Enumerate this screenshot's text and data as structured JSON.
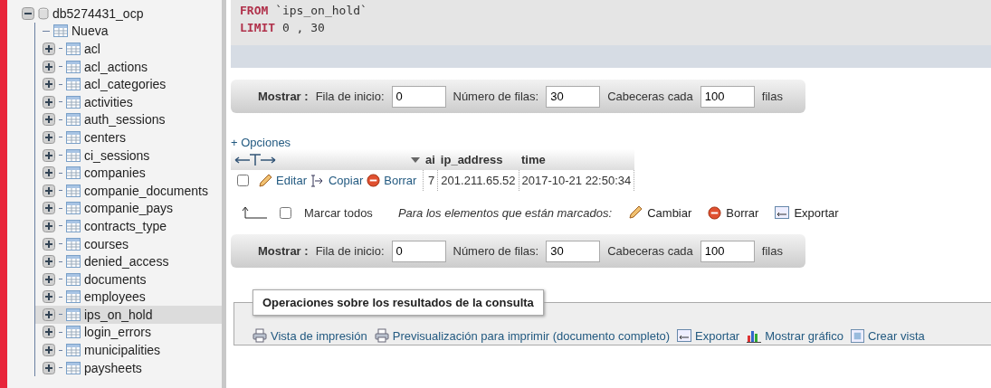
{
  "tree": {
    "label": "db5274431_ocp",
    "expanded": true,
    "children": [
      {
        "label": "Nueva",
        "kind": "new",
        "selected": false
      },
      {
        "label": "acl",
        "kind": "table",
        "selected": false
      },
      {
        "label": "acl_actions",
        "kind": "table",
        "selected": false
      },
      {
        "label": "acl_categories",
        "kind": "table",
        "selected": false
      },
      {
        "label": "activities",
        "kind": "table",
        "selected": false
      },
      {
        "label": "auth_sessions",
        "kind": "table",
        "selected": false
      },
      {
        "label": "centers",
        "kind": "table",
        "selected": false
      },
      {
        "label": "ci_sessions",
        "kind": "table",
        "selected": false
      },
      {
        "label": "companies",
        "kind": "table",
        "selected": false
      },
      {
        "label": "companie_documents",
        "kind": "table",
        "selected": false
      },
      {
        "label": "companie_pays",
        "kind": "table",
        "selected": false
      },
      {
        "label": "contracts_type",
        "kind": "table",
        "selected": false
      },
      {
        "label": "courses",
        "kind": "table",
        "selected": false
      },
      {
        "label": "denied_access",
        "kind": "table",
        "selected": false
      },
      {
        "label": "documents",
        "kind": "table",
        "selected": false
      },
      {
        "label": "employees",
        "kind": "table",
        "selected": false
      },
      {
        "label": "ips_on_hold",
        "kind": "table",
        "selected": true
      },
      {
        "label": "login_errors",
        "kind": "table",
        "selected": false
      },
      {
        "label": "municipalities",
        "kind": "table",
        "selected": false
      },
      {
        "label": "paysheets",
        "kind": "table",
        "selected": false
      }
    ]
  },
  "sql": [
    {
      "keyword": "FROM",
      "rest": "`ips_on_hold`"
    },
    {
      "keyword": "LIMIT",
      "rest": "0 , 30"
    }
  ],
  "nav_bars": [
    {
      "title": "Mostrar :",
      "start_label": "Fila de inicio:",
      "start": "0",
      "rows_label": "Número de filas:",
      "rows": "30",
      "headers_label": "Cabeceras cada",
      "headers": "100",
      "suffix": "filas"
    },
    {
      "title": "Mostrar :",
      "start_label": "Fila de inicio:",
      "start": "0",
      "rows_label": "Número de filas:",
      "rows": "30",
      "headers_label": "Cabeceras cada",
      "headers": "100",
      "suffix": "filas"
    }
  ],
  "options_link": "+ Opciones",
  "table": {
    "columns": [
      "ai",
      "ip_address",
      "time"
    ],
    "rows": [
      {
        "checked": false,
        "actions": [
          "Editar",
          "Copiar",
          "Borrar"
        ],
        "cells": [
          "7",
          "201.211.65.52",
          "2017-10-21 22:50:34"
        ]
      }
    ]
  },
  "bulk": {
    "check_all": "Marcar todos",
    "checked": false,
    "with_selected": "Para los elementos que están marcados:",
    "actions": [
      {
        "kind": "edit",
        "label": "Cambiar"
      },
      {
        "kind": "delete",
        "label": "Borrar"
      },
      {
        "kind": "export",
        "label": "Exportar"
      }
    ]
  },
  "operations": {
    "legend": "Operaciones sobre los resultados de la consulta",
    "links": [
      {
        "kind": "print",
        "label": "Vista de impresión"
      },
      {
        "kind": "print",
        "label": "Previsualización para imprimir (documento completo)"
      },
      {
        "kind": "export",
        "label": "Exportar"
      },
      {
        "kind": "chart",
        "label": "Mostrar gráfico"
      },
      {
        "kind": "view",
        "label": "Crear vista"
      }
    ]
  }
}
